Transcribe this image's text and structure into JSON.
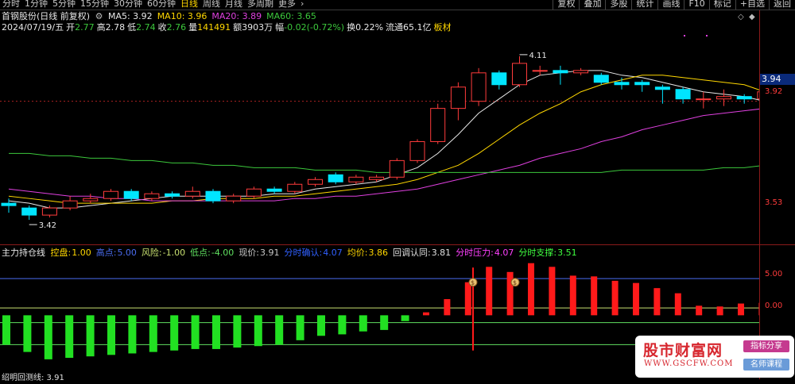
{
  "toolbar": {
    "periods": [
      "分时",
      "1分钟",
      "5分钟",
      "15分钟",
      "30分钟",
      "60分钟",
      "日线",
      "周线",
      "月线",
      "多周期",
      "更多"
    ],
    "active_period": "日线",
    "more_arrow": "›",
    "right_buttons": [
      "复权",
      "叠加",
      "多股",
      "统计",
      "画线",
      "F10",
      "标记",
      "+自选",
      "返回"
    ]
  },
  "header": {
    "stock_title": "首钢股份(日线 前复权)",
    "settings_icon": "gear-icon",
    "ma_labels": [
      {
        "text": "MA5: 3.92",
        "color": "#e8e8e8"
      },
      {
        "text": "MA10: 3.96",
        "color": "#ffd700"
      },
      {
        "text": "MA20: 3.89",
        "color": "#e040e0"
      },
      {
        "text": "MA60: 3.65",
        "color": "#3cc83c"
      }
    ]
  },
  "quote": {
    "date": "2024/07/19/五",
    "open_label": "开",
    "open": "2.77",
    "high_label": "高",
    "high": "2.78",
    "low_label": "低",
    "low": "2.74",
    "close_label": "收",
    "close": "2.76",
    "volume_label": "量",
    "volume": "141491",
    "amount_label": "额",
    "amount": "3903万",
    "change_label": "幅",
    "change": "-0.02(-0.72%)",
    "turnover_label": "换",
    "turnover": "0.22%",
    "float_label": "流通",
    "float": "65.1亿",
    "sector": "板材"
  },
  "price_axis": {
    "last_price": "3.94",
    "labels": [
      "3.92",
      "3.53"
    ],
    "high_mark": "4.11",
    "low_mark": "3.42"
  },
  "indicator": {
    "name": "主力持仓线",
    "items": [
      {
        "label": "控盘:",
        "value": "1.00",
        "color": "#ffd700"
      },
      {
        "label": "高点:",
        "value": "5.00",
        "color": "#4a6cf0"
      },
      {
        "label": "风险:",
        "value": "-1.00",
        "color": "#c8e070"
      },
      {
        "label": "低点:",
        "value": "-4.00",
        "color": "#60e060"
      },
      {
        "label": "现价:",
        "value": "3.91",
        "color": "#c8c8c8"
      },
      {
        "label": "分时确认:",
        "value": "4.07",
        "color": "#3060ff"
      },
      {
        "label": "均价:",
        "value": "3.86",
        "color": "#ffd700"
      },
      {
        "label": "回调认同:",
        "value": "3.81",
        "color": "#e0e0e0"
      },
      {
        "label": "分时压力:",
        "value": "4.07",
        "color": "#ff40ff"
      },
      {
        "label": "分时支撑:",
        "value": "3.51",
        "color": "#40ff40"
      }
    ],
    "axis_labels": [
      "5.00",
      "0.00"
    ]
  },
  "bottom_partial": "绍明回测线: 3.91",
  "colors": {
    "up": "#ff3b3b",
    "down": "#00e5ff",
    "ma5": "#e8e8e8",
    "ma10": "#ffd700",
    "ma20": "#e040e0",
    "ma60": "#3cc83c"
  },
  "watermark": {
    "title": "股市财富网",
    "url": "WWW.GSCFW.COM",
    "tag1": "指标分享",
    "tag2": "名师课程"
  },
  "chart_data": {
    "type": "candlestick",
    "ylim": [
      3.35,
      4.2
    ],
    "candles": [
      {
        "o": 3.49,
        "h": 3.51,
        "l": 3.45,
        "c": 3.48
      },
      {
        "o": 3.47,
        "h": 3.48,
        "l": 3.42,
        "c": 3.44
      },
      {
        "o": 3.44,
        "h": 3.48,
        "l": 3.43,
        "c": 3.47
      },
      {
        "o": 3.47,
        "h": 3.52,
        "l": 3.46,
        "c": 3.5
      },
      {
        "o": 3.5,
        "h": 3.53,
        "l": 3.49,
        "c": 3.51
      },
      {
        "o": 3.51,
        "h": 3.55,
        "l": 3.5,
        "c": 3.54
      },
      {
        "o": 3.54,
        "h": 3.55,
        "l": 3.5,
        "c": 3.51
      },
      {
        "o": 3.51,
        "h": 3.54,
        "l": 3.5,
        "c": 3.53
      },
      {
        "o": 3.53,
        "h": 3.54,
        "l": 3.51,
        "c": 3.52
      },
      {
        "o": 3.52,
        "h": 3.56,
        "l": 3.51,
        "c": 3.54
      },
      {
        "o": 3.54,
        "h": 3.55,
        "l": 3.49,
        "c": 3.5
      },
      {
        "o": 3.5,
        "h": 3.53,
        "l": 3.49,
        "c": 3.52
      },
      {
        "o": 3.52,
        "h": 3.56,
        "l": 3.51,
        "c": 3.55
      },
      {
        "o": 3.55,
        "h": 3.56,
        "l": 3.53,
        "c": 3.54
      },
      {
        "o": 3.54,
        "h": 3.58,
        "l": 3.53,
        "c": 3.57
      },
      {
        "o": 3.57,
        "h": 3.6,
        "l": 3.56,
        "c": 3.59
      },
      {
        "o": 3.61,
        "h": 3.62,
        "l": 3.57,
        "c": 3.58
      },
      {
        "o": 3.58,
        "h": 3.61,
        "l": 3.57,
        "c": 3.6
      },
      {
        "o": 3.59,
        "h": 3.61,
        "l": 3.58,
        "c": 3.6
      },
      {
        "o": 3.6,
        "h": 3.68,
        "l": 3.59,
        "c": 3.67
      },
      {
        "o": 3.67,
        "h": 3.76,
        "l": 3.66,
        "c": 3.75
      },
      {
        "o": 3.75,
        "h": 3.91,
        "l": 3.74,
        "c": 3.89
      },
      {
        "o": 3.89,
        "h": 4.0,
        "l": 3.84,
        "c": 3.98
      },
      {
        "o": 3.92,
        "h": 4.06,
        "l": 3.9,
        "c": 4.04
      },
      {
        "o": 4.04,
        "h": 4.05,
        "l": 3.97,
        "c": 3.99
      },
      {
        "o": 3.99,
        "h": 4.11,
        "l": 3.98,
        "c": 4.08
      },
      {
        "o": 4.05,
        "h": 4.07,
        "l": 4.03,
        "c": 4.05
      },
      {
        "o": 4.05,
        "h": 4.07,
        "l": 3.99,
        "c": 4.04
      },
      {
        "o": 4.04,
        "h": 4.06,
        "l": 4.03,
        "c": 4.05
      },
      {
        "o": 4.03,
        "h": 4.04,
        "l": 3.99,
        "c": 4.0
      },
      {
        "o": 4.0,
        "h": 4.02,
        "l": 3.97,
        "c": 3.99
      },
      {
        "o": 4.0,
        "h": 4.01,
        "l": 3.96,
        "c": 3.99
      },
      {
        "o": 3.98,
        "h": 3.99,
        "l": 3.91,
        "c": 3.97
      },
      {
        "o": 3.97,
        "h": 3.98,
        "l": 3.91,
        "c": 3.93
      },
      {
        "o": 3.93,
        "h": 3.96,
        "l": 3.89,
        "c": 3.93
      },
      {
        "o": 3.93,
        "h": 3.97,
        "l": 3.9,
        "c": 3.94
      },
      {
        "o": 3.94,
        "h": 3.95,
        "l": 3.91,
        "c": 3.93
      },
      {
        "o": 3.93,
        "h": 3.97,
        "l": 3.92,
        "c": 3.96
      }
    ],
    "ma_series": [
      {
        "name": "MA5",
        "values": [
          3.5,
          3.49,
          3.47,
          3.47,
          3.48,
          3.49,
          3.5,
          3.51,
          3.52,
          3.52,
          3.52,
          3.52,
          3.52,
          3.53,
          3.53,
          3.55,
          3.56,
          3.57,
          3.58,
          3.61,
          3.64,
          3.7,
          3.78,
          3.87,
          3.93,
          3.99,
          4.03,
          4.04,
          4.05,
          4.05,
          4.03,
          4.02,
          4.0,
          3.98,
          3.96,
          3.95,
          3.94,
          3.92
        ]
      },
      {
        "name": "MA10",
        "values": [
          3.52,
          3.51,
          3.5,
          3.49,
          3.49,
          3.49,
          3.49,
          3.49,
          3.5,
          3.5,
          3.51,
          3.51,
          3.51,
          3.52,
          3.52,
          3.53,
          3.54,
          3.55,
          3.56,
          3.57,
          3.59,
          3.62,
          3.65,
          3.7,
          3.76,
          3.82,
          3.87,
          3.91,
          3.96,
          3.99,
          4.01,
          4.03,
          4.03,
          4.02,
          4.01,
          4.0,
          3.99,
          3.96
        ]
      },
      {
        "name": "MA20",
        "values": [
          3.55,
          3.54,
          3.53,
          3.52,
          3.52,
          3.51,
          3.51,
          3.5,
          3.5,
          3.5,
          3.5,
          3.5,
          3.5,
          3.5,
          3.51,
          3.51,
          3.52,
          3.52,
          3.53,
          3.54,
          3.55,
          3.57,
          3.59,
          3.61,
          3.63,
          3.65,
          3.68,
          3.7,
          3.72,
          3.75,
          3.77,
          3.8,
          3.82,
          3.84,
          3.86,
          3.87,
          3.88,
          3.89
        ]
      },
      {
        "name": "MA60",
        "values": [
          3.7,
          3.7,
          3.69,
          3.69,
          3.68,
          3.68,
          3.67,
          3.67,
          3.66,
          3.66,
          3.65,
          3.65,
          3.64,
          3.64,
          3.64,
          3.63,
          3.63,
          3.63,
          3.62,
          3.62,
          3.62,
          3.62,
          3.62,
          3.62,
          3.62,
          3.62,
          3.62,
          3.62,
          3.62,
          3.62,
          3.63,
          3.63,
          3.63,
          3.63,
          3.63,
          3.64,
          3.64,
          3.65
        ]
      }
    ],
    "indicator_bars": [
      -4.0,
      -5.0,
      -6.0,
      -5.8,
      -5.6,
      -5.4,
      -5.2,
      -5.0,
      -4.8,
      -4.6,
      -4.6,
      -4.4,
      -4.2,
      -4.0,
      -3.4,
      -2.8,
      -2.6,
      -2.2,
      -2.0,
      -0.8,
      0.4,
      2.2,
      4.5,
      6.6,
      5.9,
      7.1,
      6.6,
      5.4,
      5.3,
      4.7,
      4.4,
      3.7,
      3.0,
      1.3,
      1.2,
      1.6,
      1.7
    ],
    "indicator_ylim": [
      -8.5,
      7.5
    ],
    "indicator_lines": [
      {
        "name": "高点",
        "value": 5.0,
        "color": "#4a6cf0"
      },
      {
        "name": "控盘",
        "value": 1.0,
        "color": "#c8e070"
      },
      {
        "name": "风险",
        "value": -1.0,
        "color": "#60e060"
      },
      {
        "name": "低点",
        "value": -4.0,
        "color": "#60e060"
      }
    ],
    "markers": [
      {
        "index": 22,
        "icon": "money-bag-icon"
      },
      {
        "index": 24,
        "icon": "money-bag-icon"
      }
    ]
  }
}
